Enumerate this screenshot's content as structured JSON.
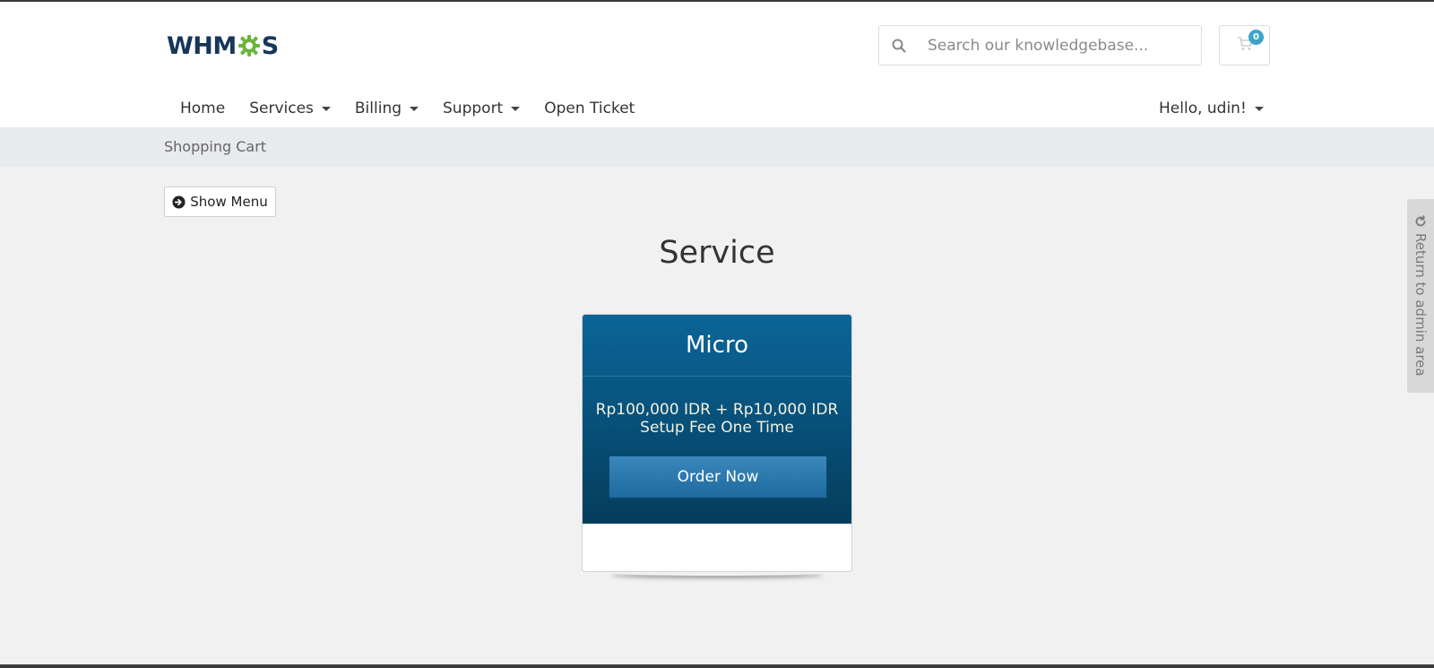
{
  "header": {
    "logo_prefix": "WHM",
    "logo_suffix": "S",
    "search": {
      "placeholder": "Search our knowledgebase..."
    },
    "cart": {
      "count": "0"
    }
  },
  "nav": {
    "items": [
      {
        "label": "Home",
        "dropdown": false
      },
      {
        "label": "Services",
        "dropdown": true
      },
      {
        "label": "Billing",
        "dropdown": true
      },
      {
        "label": "Support",
        "dropdown": true
      },
      {
        "label": "Open Ticket",
        "dropdown": false
      }
    ],
    "user_greeting": "Hello, udin!"
  },
  "breadcrumb": {
    "current": "Shopping Cart"
  },
  "sidebar_toggle": {
    "label": "Show Menu"
  },
  "page": {
    "title": "Service"
  },
  "product": {
    "name": "Micro",
    "price_line1": "Rp100,000 IDR + Rp10,000 IDR",
    "price_line2": "Setup Fee One Time",
    "order_label": "Order Now"
  },
  "admin_link": {
    "label": "Return to admin area"
  },
  "colors": {
    "logo_text": "#16375a",
    "logo_gear": "#6ab43e",
    "product_header": "#0a6597",
    "order_button": "#2a77ad",
    "cart_badge": "#3ca5c6"
  }
}
